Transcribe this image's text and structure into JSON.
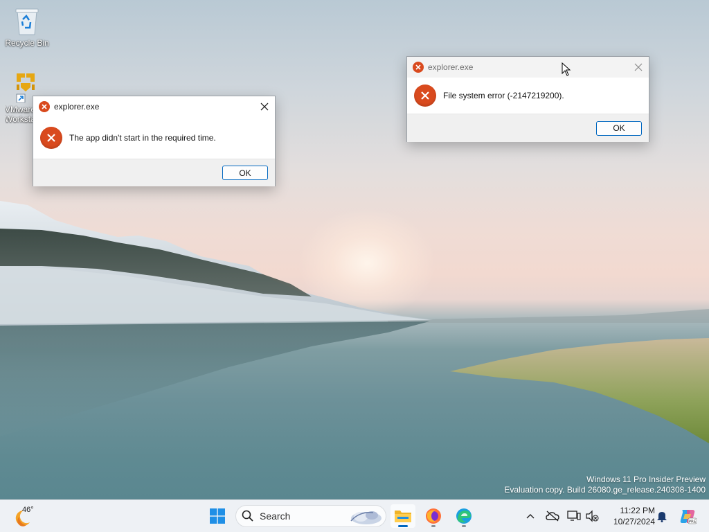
{
  "desktop": {
    "icons": [
      {
        "label": "Recycle Bin"
      },
      {
        "label": "VMware Workstation"
      }
    ]
  },
  "dialogs": {
    "app_timeout": {
      "title": "explorer.exe",
      "message": "The app didn't start in the required time.",
      "ok_label": "OK"
    },
    "fs_error": {
      "title": "explorer.exe",
      "message": "File system error (-2147219200).",
      "ok_label": "OK"
    }
  },
  "watermark": {
    "line1": "Windows 11 Pro Insider Preview",
    "line2": "Evaluation copy. Build 26080.ge_release.240308-1400"
  },
  "taskbar": {
    "weather_temp": "46°",
    "search_placeholder": "Search",
    "pinned": [
      "start-button",
      "search",
      "file-explorer",
      "firefox",
      "edge"
    ],
    "clock": {
      "time": "11:22 PM",
      "date": "10/27/2024"
    }
  },
  "colors": {
    "error_red": "#d94a1e",
    "accent": "#0067c0",
    "taskbar_bg": "#eef1f5"
  }
}
